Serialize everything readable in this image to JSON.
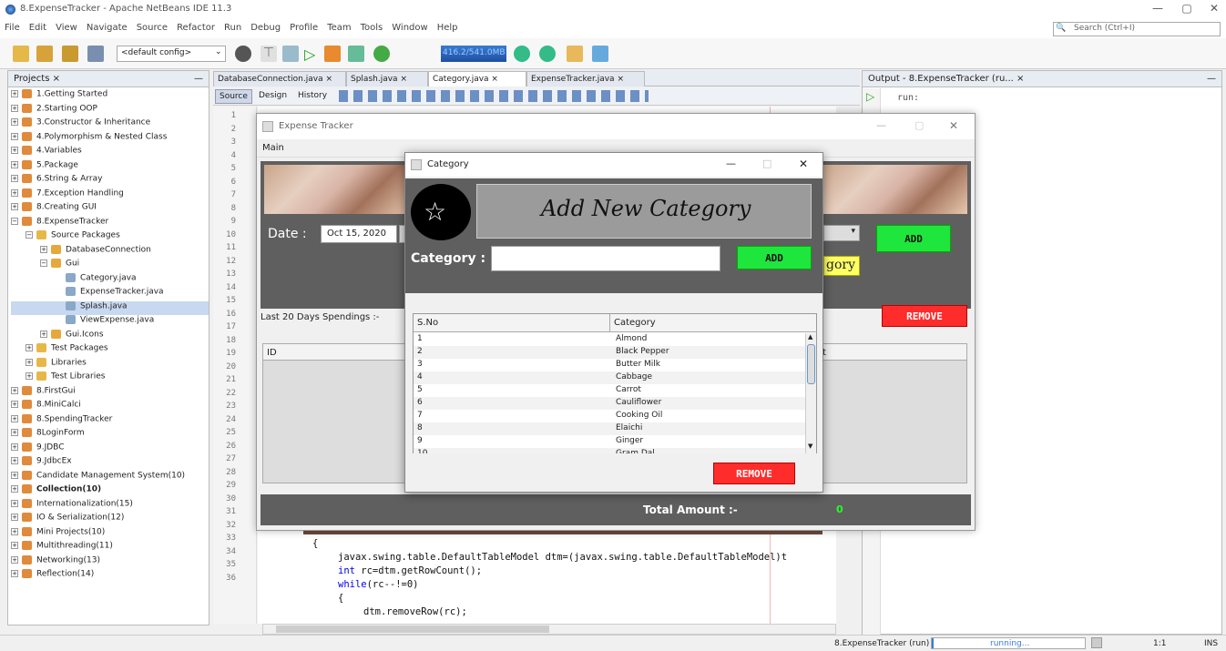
{
  "window": {
    "title": "8.ExpenseTracker - Apache NetBeans IDE 11.3",
    "min": "—",
    "max": "▢",
    "close": "✕"
  },
  "menu": [
    "File",
    "Edit",
    "View",
    "Navigate",
    "Source",
    "Refactor",
    "Run",
    "Debug",
    "Profile",
    "Team",
    "Tools",
    "Window",
    "Help"
  ],
  "toolbar": {
    "config": "<default config>",
    "memory": "416.2/541.0MB"
  },
  "search": {
    "placeholder": "Search (Ctrl+I)"
  },
  "projects": {
    "title": "Projects",
    "close": "×",
    "min": "—",
    "items": [
      {
        "label": "1.Getting Started",
        "indent": 0,
        "exp": "+",
        "icon": "project"
      },
      {
        "label": "2.Starting OOP",
        "indent": 0,
        "exp": "+",
        "icon": "project"
      },
      {
        "label": "3.Constructor & Inheritance",
        "indent": 0,
        "exp": "+",
        "icon": "project"
      },
      {
        "label": "4.Polymorphism & Nested Class",
        "indent": 0,
        "exp": "+",
        "icon": "project"
      },
      {
        "label": "4.Variables",
        "indent": 0,
        "exp": "+",
        "icon": "project"
      },
      {
        "label": "5.Package",
        "indent": 0,
        "exp": "+",
        "icon": "project"
      },
      {
        "label": "6.String & Array",
        "indent": 0,
        "exp": "+",
        "icon": "project"
      },
      {
        "label": "7.Exception Handling",
        "indent": 0,
        "exp": "+",
        "icon": "project"
      },
      {
        "label": "8.Creating GUI",
        "indent": 0,
        "exp": "+",
        "icon": "project"
      },
      {
        "label": "8.ExpenseTracker",
        "indent": 0,
        "exp": "−",
        "icon": "project"
      },
      {
        "label": "Source Packages",
        "indent": 1,
        "exp": "−",
        "icon": "folder"
      },
      {
        "label": "DatabaseConnection",
        "indent": 2,
        "exp": "+",
        "icon": "package"
      },
      {
        "label": "Gui",
        "indent": 2,
        "exp": "−",
        "icon": "package"
      },
      {
        "label": "Category.java",
        "indent": 3,
        "exp": "",
        "icon": "file"
      },
      {
        "label": "ExpenseTracker.java",
        "indent": 3,
        "exp": "",
        "icon": "file"
      },
      {
        "label": "Splash.java",
        "indent": 3,
        "exp": "",
        "icon": "file",
        "selected": true
      },
      {
        "label": "ViewExpense.java",
        "indent": 3,
        "exp": "",
        "icon": "file"
      },
      {
        "label": "Gui.Icons",
        "indent": 2,
        "exp": "+",
        "icon": "package"
      },
      {
        "label": "Test Packages",
        "indent": 1,
        "exp": "+",
        "icon": "folder"
      },
      {
        "label": "Libraries",
        "indent": 1,
        "exp": "+",
        "icon": "folder"
      },
      {
        "label": "Test Libraries",
        "indent": 1,
        "exp": "+",
        "icon": "folder"
      },
      {
        "label": "8.FirstGui",
        "indent": 0,
        "exp": "+",
        "icon": "project"
      },
      {
        "label": "8.MiniCalci",
        "indent": 0,
        "exp": "+",
        "icon": "project"
      },
      {
        "label": "8.SpendingTracker",
        "indent": 0,
        "exp": "+",
        "icon": "project"
      },
      {
        "label": "8LoginForm",
        "indent": 0,
        "exp": "+",
        "icon": "project"
      },
      {
        "label": "9.JDBC",
        "indent": 0,
        "exp": "+",
        "icon": "project"
      },
      {
        "label": "9.JdbcEx",
        "indent": 0,
        "exp": "+",
        "icon": "project"
      },
      {
        "label": "Candidate Management System(10)",
        "indent": 0,
        "exp": "+",
        "icon": "project"
      },
      {
        "label": "Collection(10)",
        "indent": 0,
        "exp": "+",
        "icon": "project",
        "bold": true
      },
      {
        "label": "Internationalization(15)",
        "indent": 0,
        "exp": "+",
        "icon": "project"
      },
      {
        "label": "IO & Serialization(12)",
        "indent": 0,
        "exp": "+",
        "icon": "project"
      },
      {
        "label": "Mini Projects(10)",
        "indent": 0,
        "exp": "+",
        "icon": "project"
      },
      {
        "label": "Multithreading(11)",
        "indent": 0,
        "exp": "+",
        "icon": "project"
      },
      {
        "label": "Networking(13)",
        "indent": 0,
        "exp": "+",
        "icon": "project"
      },
      {
        "label": "Reflection(14)",
        "indent": 0,
        "exp": "+",
        "icon": "project"
      }
    ]
  },
  "editor": {
    "tabs": [
      "DatabaseConnection.java",
      "Splash.java",
      "Category.java",
      "ExpenseTracker.java"
    ],
    "tab_close": "×",
    "modes": [
      "Source",
      "Design",
      "History"
    ],
    "line_numbers": [
      "1",
      "2",
      "3",
      "4",
      "5",
      "6",
      "7",
      "8",
      "9",
      "10",
      "11",
      "12",
      "13",
      "14",
      "15",
      "16",
      "17",
      "18",
      "19",
      "20",
      "21",
      "22",
      "23",
      "24",
      "25",
      "26",
      "27",
      "28",
      "29",
      "30",
      "31",
      "32",
      "33",
      "34",
      "35",
      "36"
    ],
    "code": {
      "l31": "{",
      "l32a": "javax.swing.table.DefaultTableModel dtm=(javax.swing.table.DefaultTableModel)t",
      "l33a": "int",
      "l33b": " rc=dtm.getRowCount();",
      "l34a": "while",
      "l34b": "(rc--!=0)",
      "l35": "{",
      "l36": "dtm.removeRow(rc);"
    }
  },
  "output": {
    "title": "Output - 8.ExpenseTracker (ru...",
    "close": "×",
    "min": "—",
    "text": "run:"
  },
  "expense_tracker": {
    "title": "Expense Tracker",
    "menu": "Main",
    "date_label": "Date :",
    "date_value": "Oct 15, 2020",
    "add": "ADD",
    "category_btn_partial": "gory",
    "spendings_label": "Last 20 Days Spendings :-",
    "remove": "REMOVE",
    "col_id": "ID",
    "col_t": "t",
    "total_label": "Total Amount :-",
    "total_value": "0"
  },
  "category_dialog": {
    "title": "Category",
    "min": "—",
    "max": "□",
    "close": "✕",
    "heading": "Add New Category",
    "field_label": "Category :",
    "field_value": "",
    "add": "ADD",
    "remove": "REMOVE",
    "columns": [
      "S.No",
      "Category"
    ],
    "rows": [
      [
        "1",
        "Almond"
      ],
      [
        "2",
        "Black Pepper"
      ],
      [
        "3",
        "Butter Milk"
      ],
      [
        "4",
        "Cabbage"
      ],
      [
        "5",
        "Carrot"
      ],
      [
        "6",
        "Cauliflower"
      ],
      [
        "7",
        "Cooking Oil"
      ],
      [
        "8",
        "Elaichi"
      ],
      [
        "9",
        "Ginger"
      ],
      [
        "10",
        "Gram Dal"
      ]
    ]
  },
  "status": {
    "process": "8.ExpenseTracker (run)",
    "state": "running...",
    "position": "1:1",
    "mode": "INS"
  }
}
